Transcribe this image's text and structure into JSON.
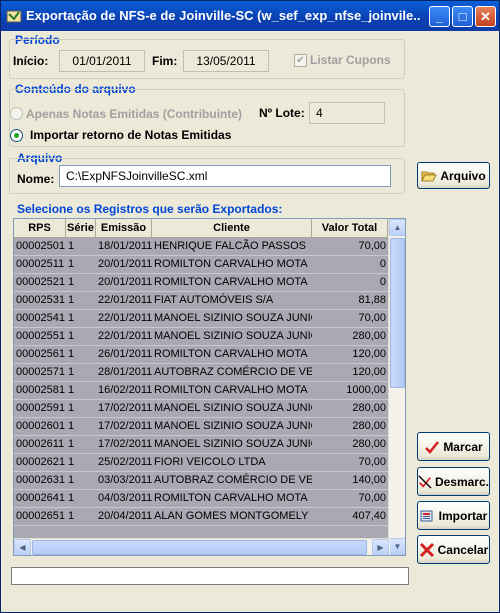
{
  "window": {
    "title": "Exportação de NFS-e de Joinville-SC (w_sef_exp_nfse_joinvile...",
    "buttons": {
      "minimize": "_",
      "maximize": "□",
      "close": "✕"
    }
  },
  "periodo": {
    "group_label": "Período",
    "inicio_label": "Início:",
    "inicio_value": "01/01/2011",
    "fim_label": "Fim:",
    "fim_value": "13/05/2011",
    "listar_cupons_label": "Listar Cupons"
  },
  "conteudo": {
    "group_label": "Conteúdo do arquivo",
    "apenas_notas_label": "Apenas Notas Emitidas (Contribuinte)",
    "lote_label": "Nº Lote:",
    "lote_value": "4",
    "importar_retorno_label": "Importar retorno de Notas Emitidas"
  },
  "arquivo": {
    "group_label": "Arquivo",
    "nome_label": "Nome:",
    "nome_value": "C:\\ExpNFSJoinvilleSC.xml",
    "button_label": "Arquivo"
  },
  "registros": {
    "group_label": "Selecione os Registros que serão Exportados:",
    "columns": [
      "RPS",
      "Série",
      "Emissão",
      "Cliente",
      "Valor Total"
    ],
    "rows": [
      [
        "00002501",
        "1",
        "18/01/2011",
        "HENRIQUE FALCÃO PASSOS",
        "70,00"
      ],
      [
        "00002511",
        "1",
        "20/01/2011",
        "ROMILTON CARVALHO MOTA",
        "0"
      ],
      [
        "00002521",
        "1",
        "20/01/2011",
        "ROMILTON CARVALHO MOTA",
        "0"
      ],
      [
        "00002531",
        "1",
        "22/01/2011",
        "FIAT AUTOMÓVEIS S/A",
        "81,88"
      ],
      [
        "00002541",
        "1",
        "22/01/2011",
        "MANOEL SIZINIO SOUZA JUNIOR",
        "70,00"
      ],
      [
        "00002551",
        "1",
        "22/01/2011",
        "MANOEL SIZINIO SOUZA JUNIOR",
        "280,00"
      ],
      [
        "00002561",
        "1",
        "26/01/2011",
        "ROMILTON CARVALHO MOTA",
        "120,00"
      ],
      [
        "00002571",
        "1",
        "28/01/2011",
        "AUTOBRAZ COMÉRCIO DE VEÍCUL",
        "120,00"
      ],
      [
        "00002581",
        "1",
        "16/02/2011",
        "ROMILTON CARVALHO MOTA",
        "1000,00"
      ],
      [
        "00002591",
        "1",
        "17/02/2011",
        "MANOEL SIZINIO SOUZA JUNIOR",
        "280,00"
      ],
      [
        "00002601",
        "1",
        "17/02/2011",
        "MANOEL SIZINIO SOUZA JUNIOR",
        "280,00"
      ],
      [
        "00002611",
        "1",
        "17/02/2011",
        "MANOEL SIZINIO SOUZA JUNIOR",
        "280,00"
      ],
      [
        "00002621",
        "1",
        "25/02/2011",
        "FIORI VEICOLO LTDA",
        "70,00"
      ],
      [
        "00002631",
        "1",
        "03/03/2011",
        "AUTOBRAZ COMÉRCIO DE VEÍCUL",
        "140,00"
      ],
      [
        "00002641",
        "1",
        "04/03/2011",
        "ROMILTON CARVALHO MOTA",
        "70,00"
      ],
      [
        "00002651",
        "1",
        "20/04/2011",
        " ALAN GOMES MONTGOMELY H",
        "407,40"
      ]
    ]
  },
  "actions": {
    "marcar": "Marcar",
    "desmarcar": "Desmarc.",
    "importar": "Importar",
    "cancelar": "Cancelar"
  },
  "colors": {
    "group_label": "#0046d5",
    "titlebar": "#0a5fd8",
    "row_bg": "#a9a9b4"
  },
  "icons": {
    "app": "app-icon",
    "folder": "folder-open-icon",
    "check": "check-mark-icon",
    "uncheck": "uncheck-icon",
    "import": "import-icon",
    "cancel": "cancel-x-icon"
  }
}
